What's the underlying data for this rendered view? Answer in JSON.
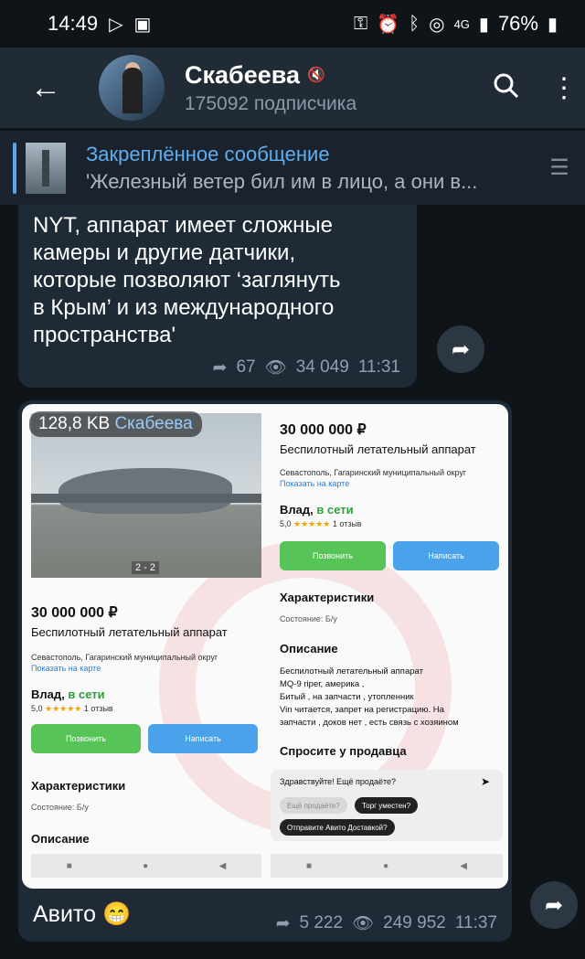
{
  "status": {
    "time": "14:49",
    "battery": "76%",
    "network": "4G"
  },
  "header": {
    "channel_name": "Скабеева",
    "subscribers": "175092 подписчика",
    "back_icon": "arrow-left",
    "search_icon": "search"
  },
  "pinned": {
    "title": "Закреплённое сообщение",
    "text": "'Железный ветер бил им в лицо, а они в..."
  },
  "message1": {
    "text": "NYT, аппарат имеет сложные\nкамеры и другие датчики,\nкоторые позволяют ‘заглянуть\nв Крым’ и из международного\nпространства'",
    "shares": "67",
    "views": "34 049",
    "time": "11:31"
  },
  "message2": {
    "size": "128,8 KB",
    "channel": "Скабеева",
    "caption": "Авито 😁",
    "shares": "5 222",
    "views": "249 952",
    "time": "11:37",
    "ad_left": {
      "counter": "2 - 2",
      "price": "30 000 000 ₽",
      "name": "Беспилотный летательный аппарат",
      "location": "Севастополь, Гагаринский муниципальный округ",
      "map_link": "Показать на карте",
      "seller": "Влад,",
      "online": "в сети",
      "rating_value": "5,0",
      "stars": "★★★★★",
      "reviews": "1 отзыв",
      "call_btn": "Позвонить",
      "write_btn": "Написать",
      "characteristics": "Характеристики",
      "condition": "Состояние: Б/у",
      "description": "Описание"
    },
    "ad_right": {
      "price": "30 000 000 ₽",
      "name": "Беспилотный летательный аппарат",
      "location": "Севастополь, Гагаринский муниципальный округ",
      "map_link": "Показать на карте",
      "seller": "Влад,",
      "online": "в сети",
      "rating_value": "5,0",
      "stars": "★★★★★",
      "reviews": "1 отзыв",
      "call_btn": "Позвонить",
      "write_btn": "Написать",
      "characteristics": "Характеристики",
      "condition": "Состояние: Б/у",
      "description": "Описание",
      "desc_text": "Беспилотный летательный аппарат\nMQ-9 ripeг, америка ,\nБитый , на запчасти , утопленник\nVin читается, запрет на регистрацию. На\nзапчасти , доков нет , есть связь с хозяином",
      "ask_seller": "Спросите у продавца",
      "chat_prompt": "Здравствуйте! Ещё продаёте?",
      "chip1": "Ещё продаёте?",
      "chip2": "Торг уместен?",
      "chip3": "Отправите Авито Доставкой?"
    }
  }
}
